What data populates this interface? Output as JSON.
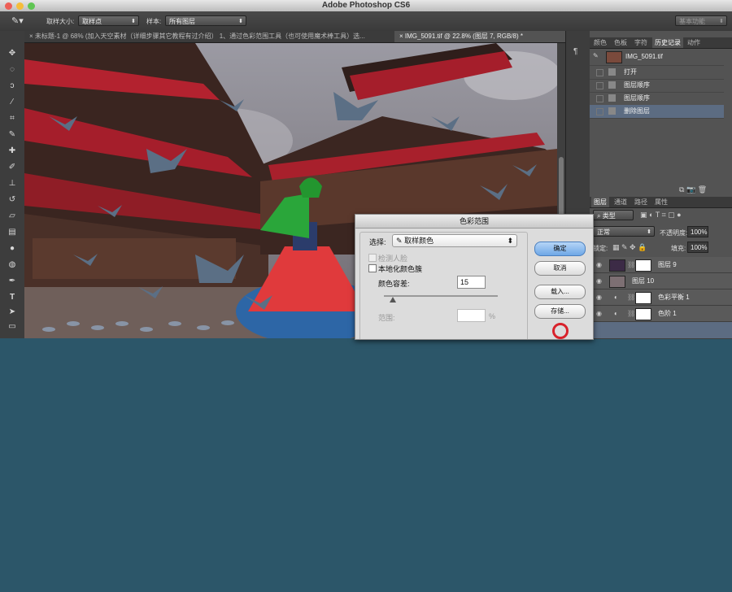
{
  "app": {
    "title": "Adobe Photoshop CS6"
  },
  "options_bar": {
    "sample_size_label": "取样大小:",
    "sample_size_value": "取样点",
    "sample_label": "样本:",
    "sample_value": "所有图层",
    "workspace": "基本功能"
  },
  "documents": {
    "tabs": [
      {
        "label": "未标题-1 @ 68% (加入天空素材（详细步骤其它教程有过介绍） 1、通过色彩范围工具（也可使用魔术棒工具）选..."
      },
      {
        "label": "IMG_5091.tif @ 22.8% (图层 7, RGB/8) *"
      }
    ]
  },
  "history_panel": {
    "tabs": [
      "颜色",
      "色板",
      "字符",
      "历史记录",
      "动作"
    ],
    "snapshot": "IMG_5091.tif",
    "items": [
      "打开",
      "图层顺序",
      "图层顺序",
      "删除图层"
    ]
  },
  "layers_panel": {
    "tabs": [
      "图层",
      "通道",
      "路径",
      "属性"
    ],
    "filter_label": "类型",
    "blend_mode": "正常",
    "opacity_label": "不透明度:",
    "opacity_value": "100%",
    "lock_label": "锁定:",
    "fill_label": "填充:",
    "fill_value": "100%",
    "layers": [
      {
        "name": "图层 9"
      },
      {
        "name": "图层 10"
      },
      {
        "name": "色彩平衡 1"
      },
      {
        "name": "色阶 1"
      }
    ]
  },
  "color_range_dialog": {
    "title": "色彩范围",
    "select_label": "选择:",
    "select_value": "取样颜色",
    "detect_faces": "检测人脸",
    "localized_clusters": "本地化颜色簇",
    "fuzziness_label": "颜色容差:",
    "fuzziness_value": "15",
    "range_label": "范围:",
    "range_unit": "%",
    "ok": "确定",
    "cancel": "取消",
    "load": "载入...",
    "save": "存储..."
  }
}
